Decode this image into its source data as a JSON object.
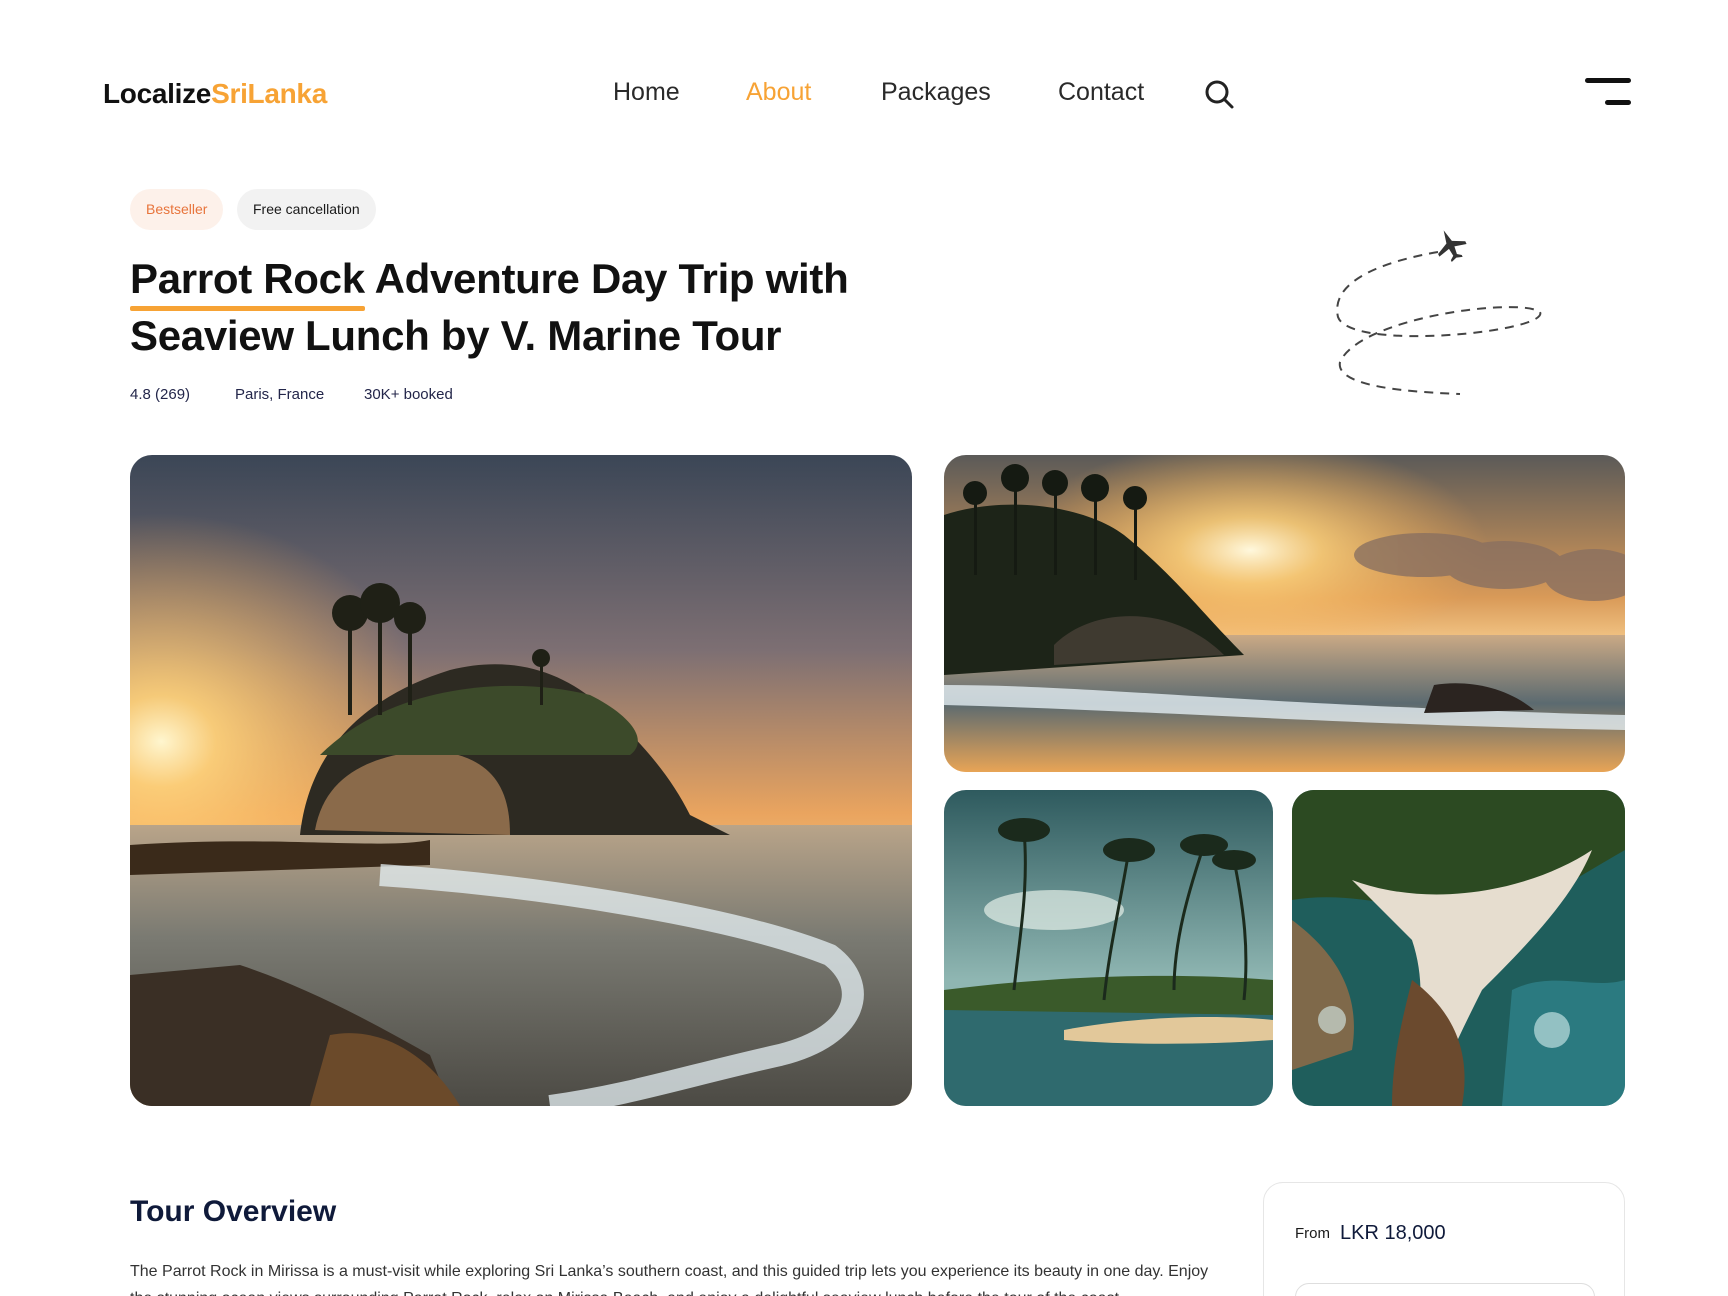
{
  "header": {
    "logo_part1": "Localize",
    "logo_part2": "SriLanka",
    "nav": [
      {
        "label": "Home",
        "active": false
      },
      {
        "label": "About",
        "active": true
      },
      {
        "label": "Packages",
        "active": false
      },
      {
        "label": "Contact",
        "active": false
      }
    ],
    "search_icon": "search-icon",
    "menu_icon": "hamburger-menu-icon"
  },
  "hero": {
    "badges": [
      "Bestseller",
      "Free cancellation"
    ],
    "title_highlight": "Parrot Rock",
    "title_rest": " Adventure Day Trip with Seaview Lunch by V. Marine Tour",
    "rating": "4.8 (269)",
    "location": "Paris, France",
    "booked": "30K+ booked",
    "decoration_icon": "airplane-icon"
  },
  "gallery": {
    "photos": [
      "parrot-rock-sunset",
      "palm-island-sunset",
      "palm-beach",
      "aerial-coast"
    ]
  },
  "overview": {
    "title": "Tour Overview",
    "text": "The Parrot Rock in Mirissa is a must-visit while exploring Sri Lanka’s southern coast, and this guided trip lets you experience its beauty in one day. Enjoy the stunning ocean views surrounding Parrot Rock, relax on Mirissa Beach, and enjoy a delightful seaview lunch before the tour of the coast."
  },
  "booking": {
    "from_label": "From",
    "price": "LKR 18,000"
  },
  "colors": {
    "accent": "#f7a335",
    "badge_orange": "#e8743b",
    "dark_navy": "#0f1a3a"
  }
}
